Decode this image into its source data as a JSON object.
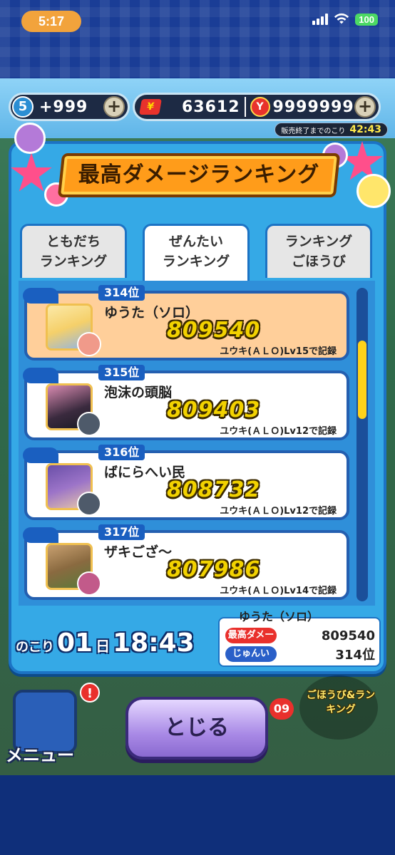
{
  "status_bar": {
    "time": "5:17",
    "battery": "100"
  },
  "currency": {
    "stamina_level": "5",
    "stamina_value": "+999",
    "money_value": "63612",
    "coin_value": "9999999",
    "sale_label": "販売終了までのこり",
    "sale_timer": "42:43"
  },
  "dialog": {
    "title": "最高ダメージランキング",
    "tabs": [
      {
        "line1": "ともだち",
        "line2": "ランキング"
      },
      {
        "line1": "ぜんたい",
        "line2": "ランキング"
      },
      {
        "line1": "ランキング",
        "line2": "ごほうび"
      }
    ],
    "entries": [
      {
        "rank": "314位",
        "name": "ゆうた（ソロ）",
        "score": "809540",
        "record": "ユウキ(ＡＬＯ)Lv15で記録"
      },
      {
        "rank": "315位",
        "name": "泡沫の頭脳",
        "score": "809403",
        "record": "ユウキ(ＡＬＯ)Lv12で記録"
      },
      {
        "rank": "316位",
        "name": "ばにらへい民",
        "score": "808732",
        "record": "ユウキ(ＡＬＯ)Lv12で記録"
      },
      {
        "rank": "317位",
        "name": "ザキござ～",
        "score": "807986",
        "record": "ユウキ(ＡＬＯ)Lv14で記録"
      }
    ],
    "remaining": {
      "label": "のこり",
      "days": "01",
      "day_unit": "日",
      "time": "18:43"
    },
    "my_record": {
      "name": "ゆうた（ソロ）",
      "damage_label": "最高ダメージ",
      "damage_value": "809540",
      "rank_label": "じゅんい",
      "rank_value": "314位"
    }
  },
  "bottom": {
    "close_label": "とじる",
    "menu_label": "メニュー",
    "menu_badge": "!",
    "reward_label": "ごほうび&ランキング",
    "badge_count": "09"
  }
}
